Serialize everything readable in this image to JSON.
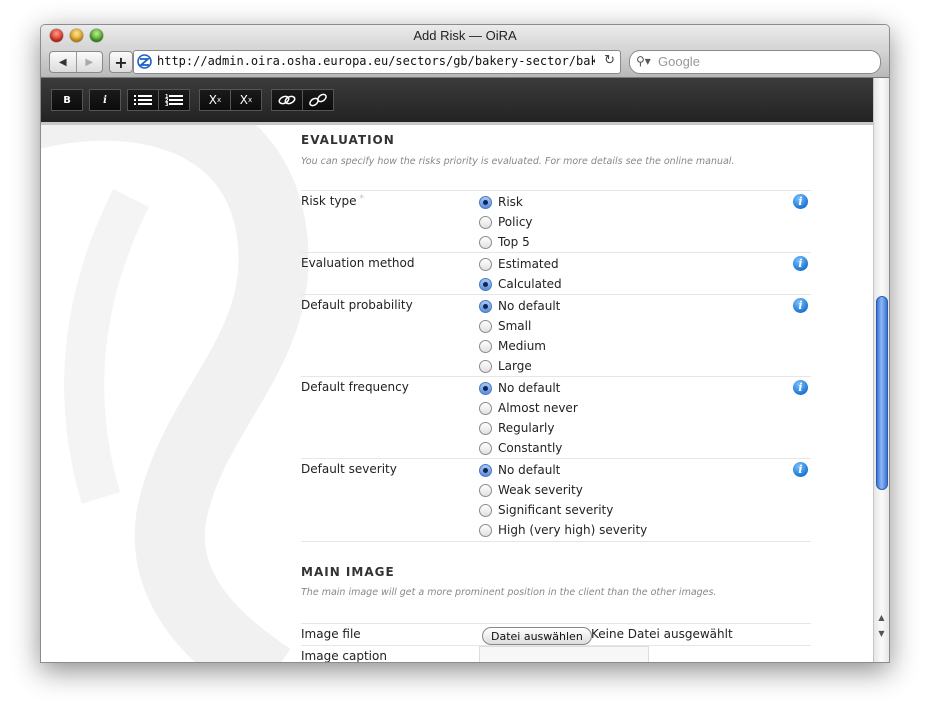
{
  "window": {
    "title": "Add Risk — OiRA"
  },
  "browser": {
    "url": "http://admin.oira.osha.europa.eu/sectors/gb/bakery-sector/bakeries/sta",
    "search_placeholder": "Google",
    "back_icon": "back-arrow-icon",
    "forward_icon": "forward-arrow-icon"
  },
  "editor_toolbar": {
    "bold": "B",
    "italic": "i",
    "subscript": "Xx",
    "superscript": "Xx"
  },
  "evaluation": {
    "title": "EVALUATION",
    "description": "You can specify how the risks priority is evaluated. For more details see the online manual.",
    "fields": [
      {
        "label": "Risk type",
        "required_mark": "*",
        "options": [
          "Risk",
          "Policy",
          "Top 5"
        ],
        "selected": "Risk"
      },
      {
        "label": "Evaluation method",
        "options": [
          "Estimated",
          "Calculated"
        ],
        "selected": "Calculated"
      },
      {
        "label": "Default probability",
        "options": [
          "No default",
          "Small",
          "Medium",
          "Large"
        ],
        "selected": "No default"
      },
      {
        "label": "Default frequency",
        "options": [
          "No default",
          "Almost never",
          "Regularly",
          "Constantly"
        ],
        "selected": "No default"
      },
      {
        "label": "Default severity",
        "options": [
          "No default",
          "Weak severity",
          "Significant severity",
          "High (very high) severity"
        ],
        "selected": "No default"
      }
    ]
  },
  "main_image": {
    "title": "MAIN IMAGE",
    "description": "The main image will get a more prominent position in the client than the other images.",
    "image_file_label": "Image file",
    "file_button": "Datei auswählen",
    "file_status": "Keine Datei ausgewählt",
    "image_caption_label": "Image caption"
  },
  "colors": {
    "accent": "#1671d0",
    "radio_selected": "#5b8fd8",
    "toolbar_dark": "#2a2a2a"
  }
}
